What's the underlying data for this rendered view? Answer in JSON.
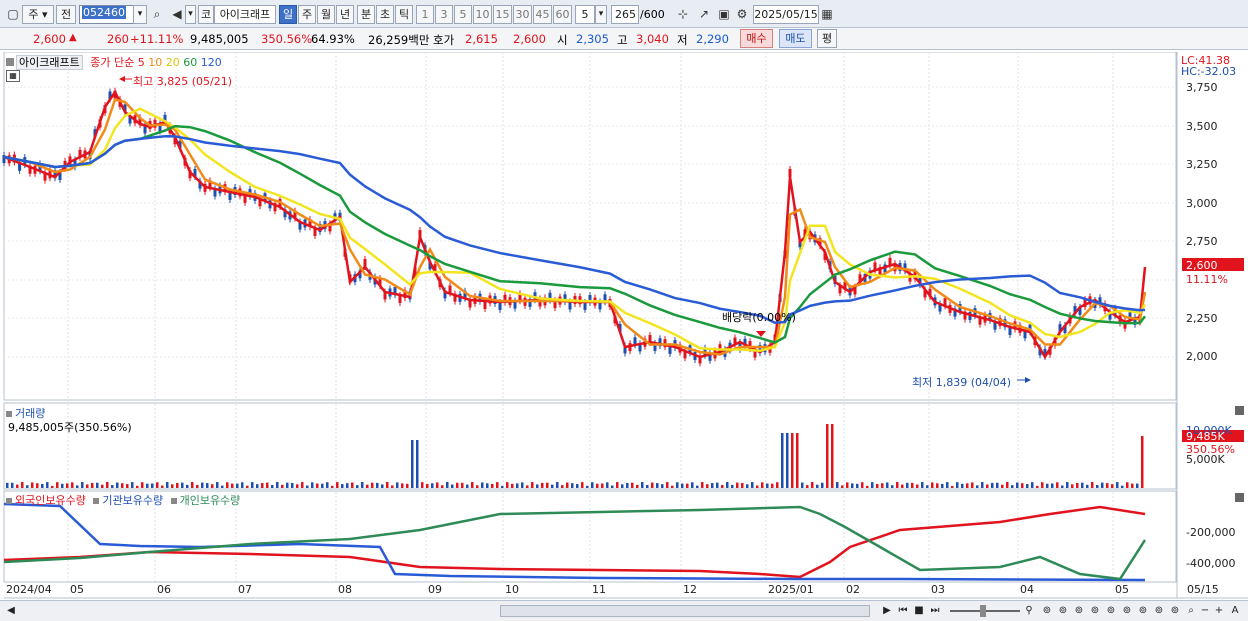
{
  "toolbar": {
    "market_label": "주",
    "prev_label": "전",
    "stock_code": "052460",
    "code_type": "코",
    "stock_name": "아이크래프",
    "period_tabs": [
      "일",
      "주",
      "월",
      "년",
      "분",
      "초",
      "틱"
    ],
    "selected_period": "일",
    "minute_buttons": [
      "1",
      "3",
      "5",
      "10",
      "15",
      "30",
      "45",
      "60"
    ],
    "count_value": "5",
    "range_value": "265",
    "range_total": "/600",
    "date_value": "2025/05/15"
  },
  "info_bar": {
    "price": "2,600",
    "change": "260",
    "change_rate": "+11.11%",
    "volume": "9,485,005",
    "volume_rate": "350.56%",
    "turnover": "64.93%",
    "amount": "26,259백만",
    "ask_label": "호가",
    "ask1": "2,615",
    "ask2": "2,600",
    "open_label": "시",
    "open": "2,305",
    "high_label": "고",
    "high": "3,040",
    "low_label": "저",
    "low": "2,290",
    "buy_label": "매수",
    "sell_label": "매도",
    "eval_label": "평"
  },
  "main_chart": {
    "stock_title": "아이크래프트",
    "ma_label": "종가 단순",
    "ma_periods": [
      "5",
      "10",
      "20",
      "60",
      "120"
    ],
    "ma_colors": [
      "#e1141e",
      "#f28a17",
      "#f2e51f",
      "#1a9a3c",
      "#2a5bd6"
    ],
    "high_marker": "최고 3,825 (05/21)",
    "low_marker": "최저 1,839 (04/04)",
    "dividend_marker": "배당락(0.00%)",
    "lc_label": "LC:41.38",
    "hc_label": "HC:-32.03",
    "y_ticks": [
      "3,750",
      "3,500",
      "3,250",
      "3,000",
      "2,750",
      "2,500",
      "2,250",
      "2,000"
    ],
    "current_price_tag": "2,600",
    "current_rate_tag": "11.11%"
  },
  "volume_chart": {
    "title": "거래량",
    "value_label": "9,485,005주(350.56%)",
    "y_ticks": [
      "10,000K",
      "5,000K"
    ],
    "current_tag": "9,485K",
    "current_rate": "350.56%"
  },
  "holding_chart": {
    "legend": [
      "외국인보유수량",
      "기관보유수량",
      "개인보유수량"
    ],
    "legend_colors": [
      "#e1141e",
      "#2a5bd6",
      "#2e8b57"
    ],
    "y_ticks": [
      "-200,000",
      "-400,000"
    ]
  },
  "x_axis": {
    "labels": [
      "2024/04",
      "05",
      "06",
      "07",
      "08",
      "09",
      "10",
      "11",
      "12",
      "2025/01",
      "02",
      "03",
      "04",
      "05"
    ],
    "right_label": "05/15"
  }
}
